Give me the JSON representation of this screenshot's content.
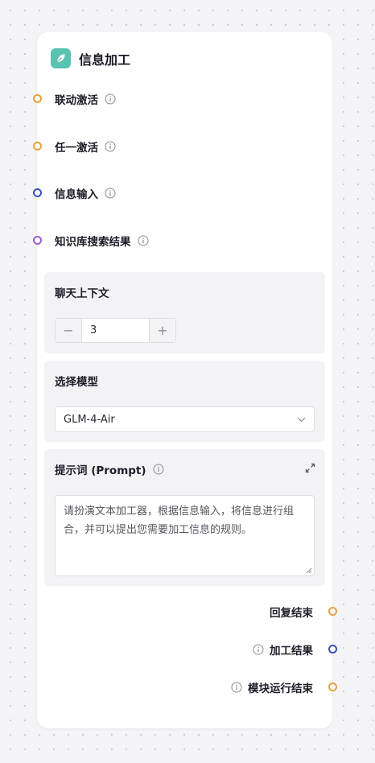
{
  "node": {
    "title": "信息加工",
    "icon": "feather-icon",
    "accent": "#5ac2b0"
  },
  "inputs": [
    {
      "label": "联动激活",
      "port_color": "#e6a23c"
    },
    {
      "label": "任一激活",
      "port_color": "#e6a23c"
    },
    {
      "label": "信息输入",
      "port_color": "#3b4fbf"
    },
    {
      "label": "知识库搜索结果",
      "port_color": "#9a5fd0"
    }
  ],
  "chat_context": {
    "title": "聊天上下文",
    "value": "3",
    "minus": "−",
    "plus": "+"
  },
  "model": {
    "title": "选择模型",
    "selected": "GLM-4-Air"
  },
  "prompt": {
    "title": "提示词 (Prompt)",
    "value": "请扮演文本加工器，根据信息输入，将信息进行组合，并可以提出您需要加工信息的规则。"
  },
  "outputs": [
    {
      "label": "回复结束",
      "port_color": "#e6a23c",
      "has_info": false
    },
    {
      "label": "加工结果",
      "port_color": "#3b4fbf",
      "has_info": true
    },
    {
      "label": "模块运行结束",
      "port_color": "#e6a23c",
      "has_info": true
    }
  ]
}
